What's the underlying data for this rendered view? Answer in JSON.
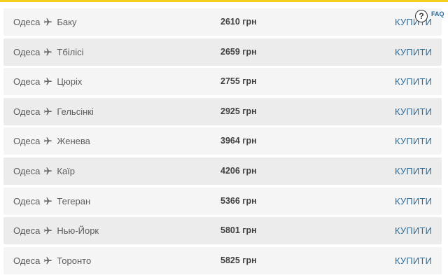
{
  "colors": {
    "accent_bar": "#f5cf1c",
    "buy_link": "#2b6d9c",
    "row_bg": "#f5f5f5",
    "row_bg_alt": "#ececec"
  },
  "icons": {
    "route_separator": "plane-icon",
    "help": "question-circle-icon"
  },
  "help": {
    "icon_glyph": "?",
    "label": "FAQ"
  },
  "flights": [
    {
      "from": "Одеса",
      "to": "Баку",
      "price": "2610 грн",
      "buy_label": "КУПИТИ"
    },
    {
      "from": "Одеса",
      "to": "Тбілісі",
      "price": "2659 грн",
      "buy_label": "КУПИТИ"
    },
    {
      "from": "Одеса",
      "to": "Цюріх",
      "price": "2755 грн",
      "buy_label": "КУПИТИ"
    },
    {
      "from": "Одеса",
      "to": "Гельсінкі",
      "price": "2925 грн",
      "buy_label": "КУПИТИ"
    },
    {
      "from": "Одеса",
      "to": "Женева",
      "price": "3964 грн",
      "buy_label": "КУПИТИ"
    },
    {
      "from": "Одеса",
      "to": "Каїр",
      "price": "4206 грн",
      "buy_label": "КУПИТИ"
    },
    {
      "from": "Одеса",
      "to": "Тегеран",
      "price": "5366 грн",
      "buy_label": "КУПИТИ"
    },
    {
      "from": "Одеса",
      "to": "Нью-Йорк",
      "price": "5801 грн",
      "buy_label": "КУПИТИ"
    },
    {
      "from": "Одеса",
      "to": "Торонто",
      "price": "5825 грн",
      "buy_label": "КУПИТИ"
    }
  ]
}
